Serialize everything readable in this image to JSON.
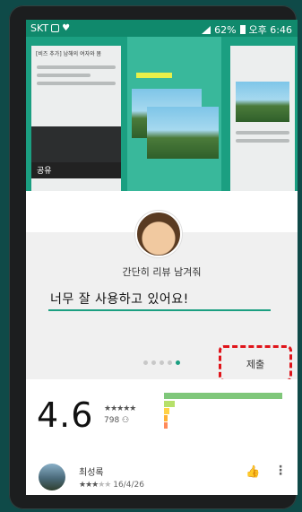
{
  "status_bar": {
    "carrier": "SKT",
    "battery": "62%",
    "time": "오후 6:46"
  },
  "carousel": {
    "shot1_title": "[비즈 추가] 남해의 여자와 봄",
    "share_label": "공유"
  },
  "review": {
    "prompt": "간단히 리뷰 남겨줘",
    "text": "너무 잘 사용하고 있어요!",
    "submit_label": "제출",
    "page_count": 5,
    "active_page": 4
  },
  "rating": {
    "score": "4.6",
    "stars": "★★★★★",
    "count": "798 ⚇",
    "distribution": {
      "5": 0.95,
      "4": 0.09,
      "3": 0.04,
      "2": 0.03,
      "1": 0.03
    }
  },
  "user_review": {
    "name": "최성록",
    "stars_on": "★★★",
    "stars_off": "★★",
    "date": "16/4/26"
  },
  "colors": {
    "accent": "#1b9f81",
    "highlight": "#e0141a"
  }
}
